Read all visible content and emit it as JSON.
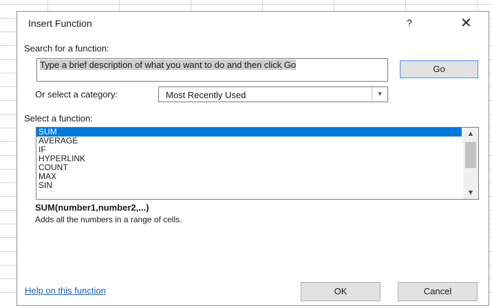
{
  "dialog": {
    "title": "Insert Function",
    "help_glyph": "?",
    "close_glyph": "✕"
  },
  "search": {
    "label": "Search for a function:",
    "value": "Type a brief description of what you want to do and then click Go",
    "go_label": "Go"
  },
  "category": {
    "label": "Or select a category:",
    "selected": "Most Recently Used"
  },
  "functions": {
    "label": "Select a function:",
    "items": [
      "SUM",
      "AVERAGE",
      "IF",
      "HYPERLINK",
      "COUNT",
      "MAX",
      "SIN"
    ],
    "selected_index": 0
  },
  "details": {
    "signature": "SUM(number1,number2,...)",
    "description": "Adds all the numbers in a range of cells."
  },
  "footer": {
    "help_link": "Help on this function",
    "ok_label": "OK",
    "cancel_label": "Cancel"
  },
  "icons": {
    "dropdown": "chevron-down-icon",
    "scroll_up": "chevron-up-icon",
    "scroll_down": "chevron-down-icon"
  },
  "colors": {
    "selection": "#0078d7",
    "link": "#1a5fb4",
    "go_border": "#4f8ed6"
  }
}
